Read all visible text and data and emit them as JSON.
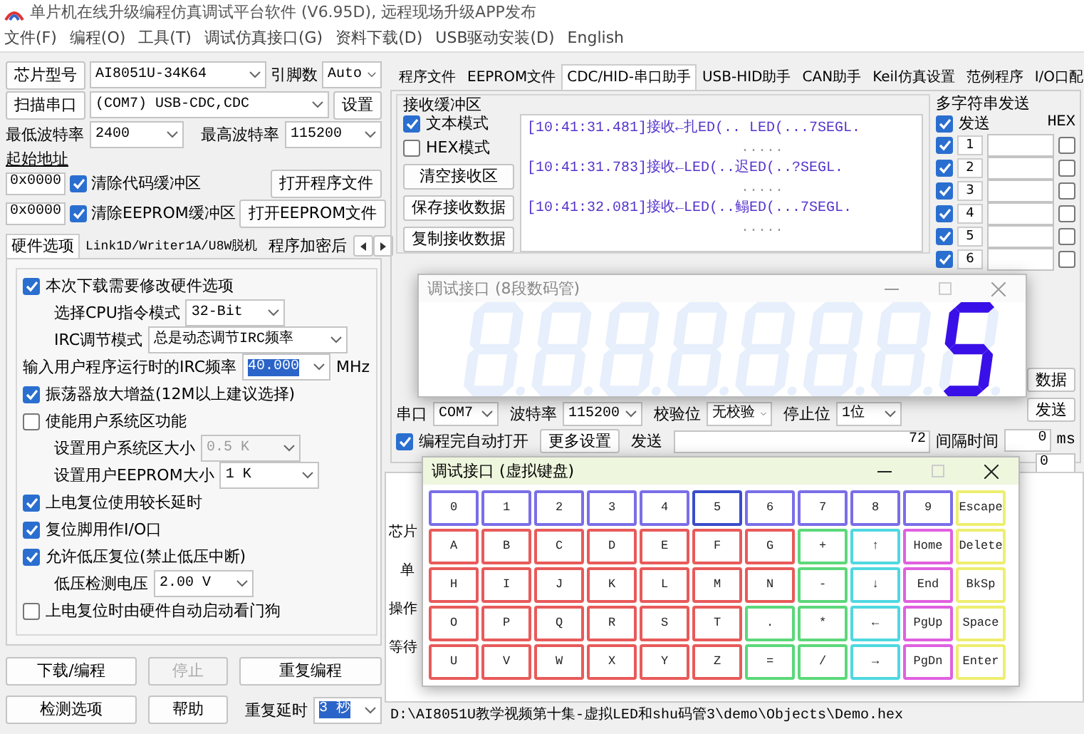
{
  "window": {
    "title": "单片机在线升级编程仿真调试平台软件 (V6.95D), 远程现场升级APP发布"
  },
  "menu": [
    "文件(F)",
    "编程(O)",
    "工具(T)",
    "调试仿真接口(G)",
    "资料下载(D)",
    "USB驱动安装(D)",
    "English"
  ],
  "chip": {
    "button": "芯片型号",
    "model": "AI8051U-34K64",
    "pins_label": "引脚数",
    "pins": "Auto"
  },
  "port": {
    "button": "扫描串口",
    "value": "(COM7) USB-CDC,CDC",
    "settings_button": "设置"
  },
  "baud": {
    "min_label": "最低波特率",
    "min": "2400",
    "max_label": "最高波特率",
    "max": "115200"
  },
  "start_address": {
    "label": "起始地址",
    "rows": [
      {
        "address": "0x0000",
        "option": "清除代码缓冲区",
        "checked": true,
        "button": "打开程序文件"
      },
      {
        "address": "0x0000",
        "option": "清除EEPROM缓冲区",
        "checked": true,
        "button": "打开EEPROM文件"
      }
    ]
  },
  "option_tabs": [
    {
      "label": "硬件选项",
      "selected": true
    },
    {
      "label": "Link1D/Writer1A/U8W脱机",
      "selected": false
    },
    {
      "label": "程序加密后",
      "selected": false
    }
  ],
  "hardware_options": [
    {
      "kind": "check",
      "label": "本次下载需要修改硬件选项",
      "checked": true
    },
    {
      "kind": "select",
      "label": "选择CPU指令模式",
      "value": "32-Bit",
      "disabled": false
    },
    {
      "kind": "select",
      "label": "IRC调节模式",
      "value": "总是动态调节IRC频率",
      "disabled": false
    },
    {
      "kind": "input",
      "label": "输入用户程序运行时的IRC频率",
      "value": "40.000",
      "unit": "MHz"
    },
    {
      "kind": "check",
      "label": "振荡器放大增益(12M以上建议选择)",
      "checked": true
    },
    {
      "kind": "check",
      "label": "使能用户系统区功能",
      "checked": false
    },
    {
      "kind": "select",
      "label": "设置用户系统区大小",
      "value": "0.5 K",
      "disabled": true
    },
    {
      "kind": "select",
      "label": "设置用户EEPROM大小",
      "value": "1 K",
      "disabled": false
    },
    {
      "kind": "check",
      "label": "上电复位使用较长延时",
      "checked": true
    },
    {
      "kind": "check",
      "label": "复位脚用作I/O口",
      "checked": true
    },
    {
      "kind": "check",
      "label": "允许低压复位(禁止低压中断)",
      "checked": true
    },
    {
      "kind": "select",
      "label": "低压检测电压",
      "value": "2.00 V",
      "disabled": false
    },
    {
      "kind": "check",
      "label": "上电复位时由硬件自动启动看门狗",
      "checked": false
    }
  ],
  "actions": [
    {
      "label": "下载/编程",
      "disabled": false
    },
    {
      "label": "停止",
      "disabled": true
    },
    {
      "label": "重复编程",
      "disabled": false
    },
    {
      "label": "检测选项",
      "disabled": false
    },
    {
      "label": "帮助",
      "disabled": false
    }
  ],
  "repeat_delay": {
    "label": "重复延时",
    "value": "3 秒"
  },
  "right_tabs": [
    {
      "label": "程序文件",
      "selected": false
    },
    {
      "label": "EEPROM文件",
      "selected": false
    },
    {
      "label": "CDC/HID-串口助手",
      "selected": true
    },
    {
      "label": "USB-HID助手",
      "selected": false
    },
    {
      "label": "CAN助手",
      "selected": false
    },
    {
      "label": "Keil仿真设置",
      "selected": false
    },
    {
      "label": "范例程序",
      "selected": false
    },
    {
      "label": "I/O口配",
      "selected": false
    }
  ],
  "receive": {
    "title": "接收缓冲区",
    "options": [
      {
        "label": "文本模式",
        "checked": true
      },
      {
        "label": "HEX模式",
        "checked": false
      }
    ],
    "buttons": [
      "清空接收区",
      "保存接收数据",
      "复制接收数据"
    ],
    "log": [
      "[10:41:31.481]接收←扎ED(.. LED(...7SEGL.",
      ".....",
      "[10:41:31.783]接收←LED(..迟ED(..?SEGL.",
      ".....",
      "[10:41:32.081]接收←LED(..鳎ED(...7SEGL.",
      "....."
    ]
  },
  "multi_send": {
    "title": "多字符串发送",
    "send": {
      "label": "发送",
      "checked": true
    },
    "hex_label": "HEX",
    "rows": [
      {
        "number": "1",
        "checked": true,
        "hex": false
      },
      {
        "number": "2",
        "checked": true,
        "hex": false
      },
      {
        "number": "3",
        "checked": true,
        "hex": false
      },
      {
        "number": "4",
        "checked": true,
        "hex": false
      },
      {
        "number": "5",
        "checked": true,
        "hex": false
      },
      {
        "number": "6",
        "checked": true,
        "hex": false
      }
    ],
    "side_buttons": [
      "数据",
      "发送"
    ],
    "interval_label": "间隔时间",
    "interval": "0",
    "unit": "ms",
    "extra": "0"
  },
  "serial": [
    {
      "label": "串口",
      "value": "COM7"
    },
    {
      "label": "波特率",
      "value": "115200"
    },
    {
      "label": "校验位",
      "value": "无校验"
    },
    {
      "label": "停止位",
      "value": "1位"
    }
  ],
  "send_row": {
    "auto_open": {
      "label": "编程完自动打开",
      "checked": true
    },
    "more_button": "更多设置",
    "send_label": "发送",
    "count": "72"
  },
  "output_fragments": [
    "芯片",
    "单",
    "操作",
    "等待"
  ],
  "status_path": "D:\\AI8051U教学视频第十集-虚拟LED和shu码管3\\demo\\Objects\\Demo.hex",
  "seg_window": {
    "title": "调试接口 (8段数码管)",
    "active": false,
    "digits": [
      {
        "segments": {
          "a": false,
          "b": false,
          "c": false,
          "d": false,
          "e": false,
          "f": false,
          "g": false
        }
      },
      {
        "segments": {
          "a": false,
          "b": false,
          "c": false,
          "d": false,
          "e": false,
          "f": false,
          "g": false
        }
      },
      {
        "segments": {
          "a": false,
          "b": false,
          "c": false,
          "d": false,
          "e": false,
          "f": false,
          "g": false
        }
      },
      {
        "segments": {
          "a": false,
          "b": false,
          "c": false,
          "d": false,
          "e": false,
          "f": false,
          "g": false
        }
      },
      {
        "segments": {
          "a": false,
          "b": false,
          "c": false,
          "d": false,
          "e": false,
          "f": false,
          "g": false
        }
      },
      {
        "segments": {
          "a": false,
          "b": false,
          "c": false,
          "d": false,
          "e": false,
          "f": false,
          "g": false
        }
      },
      {
        "segments": {
          "a": false,
          "b": false,
          "c": false,
          "d": false,
          "e": false,
          "f": false,
          "g": false
        }
      },
      {
        "segments": {
          "a": true,
          "b": false,
          "c": true,
          "d": true,
          "e": false,
          "f": true,
          "g": true
        }
      }
    ]
  },
  "keypad_window": {
    "title": "调试接口 (虚拟键盘)",
    "active": true,
    "rows": [
      [
        {
          "label": "0",
          "color": "#7a6ee8"
        },
        {
          "label": "1",
          "color": "#7a6ee8"
        },
        {
          "label": "2",
          "color": "#7a6ee8"
        },
        {
          "label": "3",
          "color": "#7a6ee8"
        },
        {
          "label": "4",
          "color": "#7a6ee8"
        },
        {
          "label": "5",
          "color": "#3a4ccc"
        },
        {
          "label": "6",
          "color": "#7a6ee8"
        },
        {
          "label": "7",
          "color": "#7a6ee8"
        },
        {
          "label": "8",
          "color": "#7a6ee8"
        },
        {
          "label": "9",
          "color": "#7a6ee8"
        },
        {
          "label": "Escape",
          "color": "#eeee70"
        }
      ],
      [
        {
          "label": "A",
          "color": "#e85a5a"
        },
        {
          "label": "B",
          "color": "#e85a5a"
        },
        {
          "label": "C",
          "color": "#e85a5a"
        },
        {
          "label": "D",
          "color": "#e85a5a"
        },
        {
          "label": "E",
          "color": "#e85a5a"
        },
        {
          "label": "F",
          "color": "#e85a5a"
        },
        {
          "label": "G",
          "color": "#e85a5a"
        },
        {
          "label": "+",
          "color": "#5cd87a"
        },
        {
          "label": "↑",
          "color": "#4fd8e0"
        },
        {
          "label": "Home",
          "color": "#e060e0"
        },
        {
          "label": "Delete",
          "color": "#eeee70"
        }
      ],
      [
        {
          "label": "H",
          "color": "#e85a5a"
        },
        {
          "label": "I",
          "color": "#e85a5a"
        },
        {
          "label": "J",
          "color": "#e85a5a"
        },
        {
          "label": "K",
          "color": "#e85a5a"
        },
        {
          "label": "L",
          "color": "#e85a5a"
        },
        {
          "label": "M",
          "color": "#e85a5a"
        },
        {
          "label": "N",
          "color": "#e85a5a"
        },
        {
          "label": "-",
          "color": "#5cd87a"
        },
        {
          "label": "↓",
          "color": "#4fd8e0"
        },
        {
          "label": "End",
          "color": "#e060e0"
        },
        {
          "label": "BkSp",
          "color": "#eeee70"
        }
      ],
      [
        {
          "label": "O",
          "color": "#e85a5a"
        },
        {
          "label": "P",
          "color": "#e85a5a"
        },
        {
          "label": "Q",
          "color": "#e85a5a"
        },
        {
          "label": "R",
          "color": "#e85a5a"
        },
        {
          "label": "S",
          "color": "#e85a5a"
        },
        {
          "label": "T",
          "color": "#e85a5a"
        },
        {
          "label": ".",
          "color": "#5cd87a"
        },
        {
          "label": "*",
          "color": "#5cd87a"
        },
        {
          "label": "←",
          "color": "#4fd8e0"
        },
        {
          "label": "PgUp",
          "color": "#e060e0"
        },
        {
          "label": "Space",
          "color": "#eeee70"
        }
      ],
      [
        {
          "label": "U",
          "color": "#e85a5a"
        },
        {
          "label": "V",
          "color": "#e85a5a"
        },
        {
          "label": "W",
          "color": "#e85a5a"
        },
        {
          "label": "X",
          "color": "#e85a5a"
        },
        {
          "label": "Y",
          "color": "#e85a5a"
        },
        {
          "label": "Z",
          "color": "#e85a5a"
        },
        {
          "label": "=",
          "color": "#5cd87a"
        },
        {
          "label": "/",
          "color": "#5cd87a"
        },
        {
          "label": "→",
          "color": "#4fd8e0"
        },
        {
          "label": "PgDn",
          "color": "#e060e0"
        },
        {
          "label": "Enter",
          "color": "#eeee70"
        }
      ]
    ]
  }
}
